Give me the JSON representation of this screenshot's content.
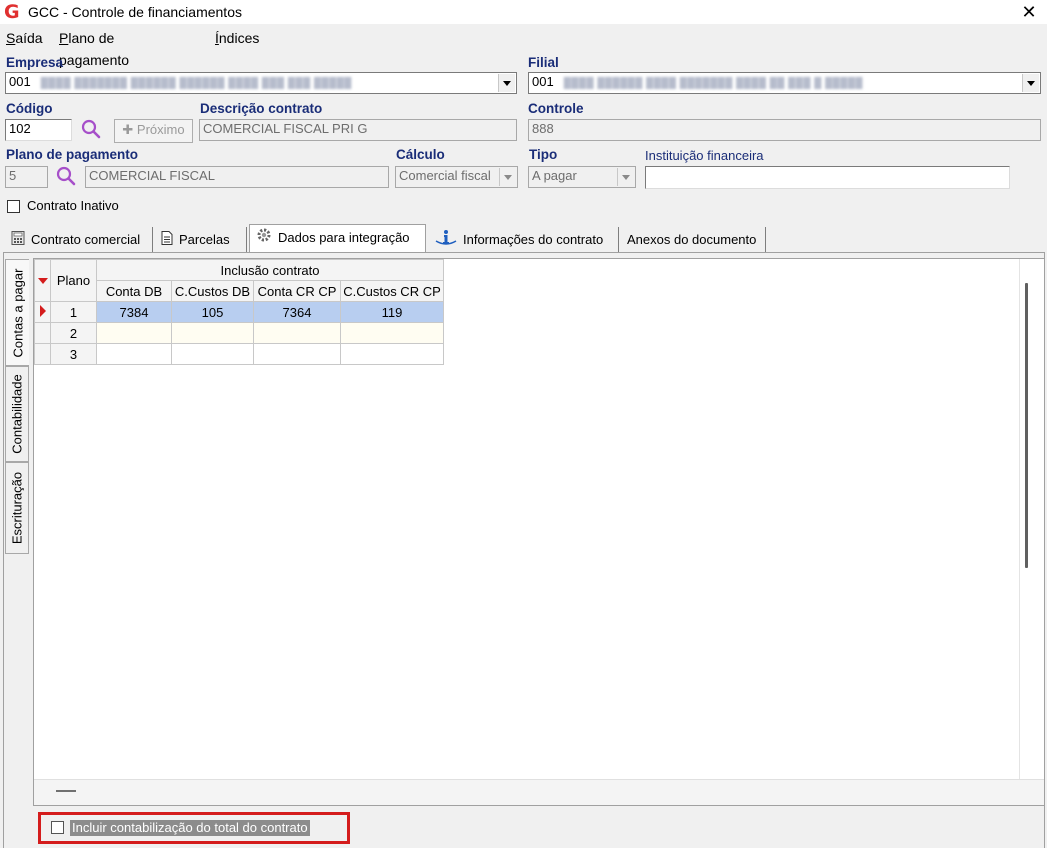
{
  "window": {
    "title": "GCC - Controle de financiamentos",
    "app_icon_glyph": "G",
    "close_glyph": "✕"
  },
  "menu": [
    {
      "label": "Saída",
      "accel": "S",
      "rest": "aída"
    },
    {
      "label": "Plano de pagamento",
      "accel": "P",
      "rest": "lano de pagamento"
    },
    {
      "label": "Índices",
      "accel": "Í",
      "rest": "ndices"
    }
  ],
  "form": {
    "empresa": {
      "label": "Empresa",
      "value": "001"
    },
    "filial": {
      "label": "Filial",
      "value": "001"
    },
    "codigo": {
      "label": "Código",
      "value": "102"
    },
    "proximo_button": {
      "label": "Próximo",
      "prefix": "✚"
    },
    "descricao": {
      "label": "Descrição contrato",
      "value": "COMERCIAL FISCAL PRI G"
    },
    "controle": {
      "label": "Controle",
      "value": "888"
    },
    "plano": {
      "label": "Plano de pagamento",
      "code": "5",
      "description": "COMERCIAL FISCAL"
    },
    "calculo": {
      "label": "Cálculo",
      "value": "Comercial fiscal"
    },
    "tipo": {
      "label": "Tipo",
      "value": "A pagar"
    },
    "instituicao": {
      "label": "Instituição financeira",
      "value": ""
    },
    "contrato_inativo": {
      "label": "Contrato Inativo",
      "checked": false
    }
  },
  "tabs": [
    {
      "label": "Contrato comercial",
      "icon": "calculator-icon",
      "active": false
    },
    {
      "label": "Parcelas",
      "icon": "document-icon",
      "active": false
    },
    {
      "label": "Dados para integração",
      "icon": "gear-icon",
      "active": true
    },
    {
      "label": "Informações do contrato",
      "icon": "info-icon",
      "active": false
    },
    {
      "label": "Anexos do documento",
      "icon": "",
      "active": false
    }
  ],
  "side_tabs": [
    {
      "label": "Contas a pagar",
      "active": true
    },
    {
      "label": "Contabilidade",
      "active": false
    },
    {
      "label": "Escrituração",
      "active": false
    }
  ],
  "grid": {
    "plano_header": "Plano",
    "group_header": "Inclusão contrato",
    "columns": [
      "Conta DB",
      "C.Custos DB",
      "Conta CR CP",
      "C.Custos CR CP"
    ],
    "rows": [
      {
        "plano": "1",
        "cells": [
          "7384",
          "105",
          "7364",
          "119"
        ],
        "selected": true
      },
      {
        "plano": "2",
        "cells": [
          "",
          "",
          "",
          ""
        ],
        "selected": false
      },
      {
        "plano": "3",
        "cells": [
          "",
          "",
          "",
          ""
        ],
        "selected": false
      }
    ]
  },
  "footer": {
    "incluir_label": "Incluir contabilização do total do contrato",
    "incluir_checked": false
  }
}
